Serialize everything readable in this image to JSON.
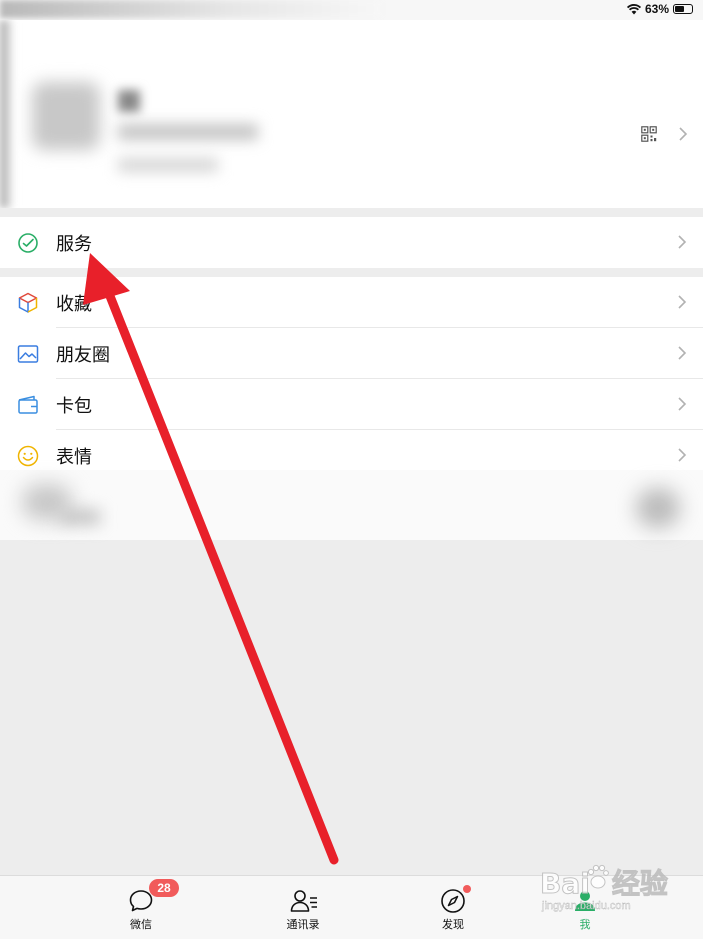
{
  "status_bar": {
    "battery_text": "63%",
    "battery_level": 0.63,
    "wifi_icon": "wifi-icon"
  },
  "profile": {
    "qr_icon": "qr-code-icon",
    "chevron_icon": "chevron-right-icon"
  },
  "menu": {
    "service": {
      "label": "服务",
      "icon": "service-check-icon",
      "color": "#2aae67"
    },
    "items": [
      {
        "label": "收藏",
        "icon": "favorites-cube-icon",
        "color": "#e0493b"
      },
      {
        "label": "朋友圈",
        "icon": "moments-image-icon",
        "color": "#3a7de0"
      },
      {
        "label": "卡包",
        "icon": "card-wallet-icon",
        "color": "#3a8ee0"
      },
      {
        "label": "表情",
        "icon": "emoji-face-icon",
        "color": "#f0b400"
      }
    ]
  },
  "tabbar": {
    "tabs": [
      {
        "label": "微信",
        "icon": "chat-bubble-icon",
        "badge": "28"
      },
      {
        "label": "通讯录",
        "icon": "contacts-icon"
      },
      {
        "label": "发现",
        "icon": "compass-icon"
      },
      {
        "label": "我",
        "icon": "me-person-icon",
        "active_color": "#2aae67"
      }
    ]
  },
  "watermark": {
    "brand": "Bai",
    "brand_cn": "经验",
    "sub": "jingyan.baidu.com"
  },
  "annotation": {
    "arrow_color": "#e8202a"
  }
}
